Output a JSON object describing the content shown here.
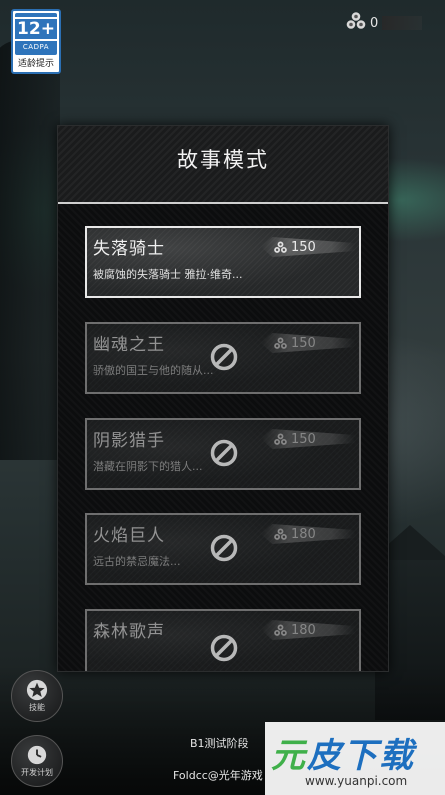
{
  "age_badge": {
    "rating": "12+",
    "org": "CADPA",
    "tip": "适龄提示"
  },
  "currency": {
    "icon": "trefoil-gem-icon",
    "value": "0"
  },
  "panel": {
    "title": "故事模式"
  },
  "stories": [
    {
      "title": "失落骑士",
      "desc": "被腐蚀的失落骑士 雅拉·维奇...",
      "cost": "150",
      "locked": false
    },
    {
      "title": "幽魂之王",
      "desc": "骄傲的国王与他的随从...",
      "cost": "150",
      "locked": true
    },
    {
      "title": "阴影猎手",
      "desc": "潜藏在阴影下的猎人...",
      "cost": "150",
      "locked": true
    },
    {
      "title": "火焰巨人",
      "desc": "远古的禁忌魔法...",
      "cost": "180",
      "locked": true
    },
    {
      "title": "森林歌声",
      "desc": "",
      "cost": "180",
      "locked": true
    }
  ],
  "side_buttons": {
    "skills": "技能",
    "dev_plan": "开发计划"
  },
  "footer": {
    "stage": "B1测试阶段",
    "credit": "Foldcc@光年游戏"
  },
  "watermark": {
    "brand_a": "元",
    "brand_b": "皮",
    "brand_c": "下载",
    "url": "www.yuanpi.com"
  },
  "colors": {
    "accent_blue": "#2e74bb",
    "watermark_green": "#3fb04a",
    "watermark_blue": "#1d6fbf"
  }
}
